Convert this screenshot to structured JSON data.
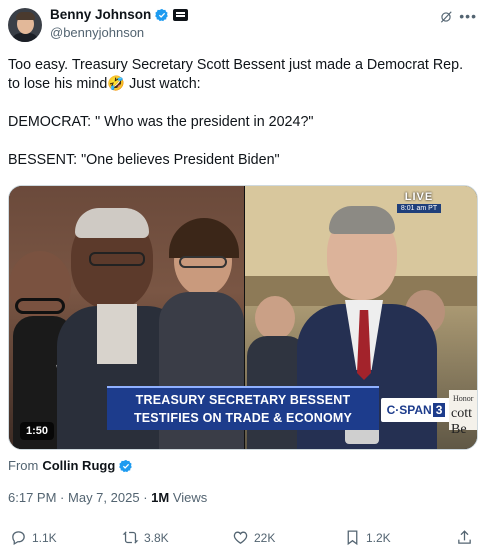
{
  "author": {
    "display_name": "Benny Johnson",
    "handle": "@bennyjohnson"
  },
  "tweet": {
    "text": "Too easy. Treasury Secretary Scott Bessent just made a Democrat Rep. to lose his mind🤣 Just watch:\n\nDEMOCRAT: \" Who was the president in 2024?\"\n\nBESSENT: \"One believes President Biden\""
  },
  "media": {
    "live_label": "LIVE",
    "live_time": "8:01 am PT",
    "chyron_line1": "TREASURY SECRETARY BESSENT",
    "chyron_line2": "TESTIFIES ON TRADE & ECONOMY",
    "network_text": "C·SPAN",
    "network_number": "3",
    "nameplate_top": "Honor",
    "nameplate_name": "cott Be",
    "duration": "1:50",
    "colors": {
      "chyron": "#1d3c8c",
      "live_bar": "#1f3f7a"
    }
  },
  "attribution": {
    "prefix": "From",
    "source_name": "Collin Rugg"
  },
  "meta": {
    "time": "6:17 PM",
    "separator": "·",
    "date": "May 7, 2025",
    "views_count": "1M",
    "views_label": "Views"
  },
  "actions": {
    "replies": "1.1K",
    "reposts": "3.8K",
    "likes": "22K",
    "bookmarks": "1.2K"
  },
  "icons": {
    "verified": "verified-badge-icon",
    "affiliate": "org-affiliate-icon",
    "grok": "grok-icon",
    "more": "more-options-icon",
    "reply": "reply-icon",
    "repost": "repost-icon",
    "like": "like-icon",
    "bookmark": "bookmark-icon",
    "share": "share-icon"
  },
  "colors": {
    "verified_blue": "#1d9bf0",
    "text_primary": "#0f1419",
    "text_secondary": "#536471"
  }
}
